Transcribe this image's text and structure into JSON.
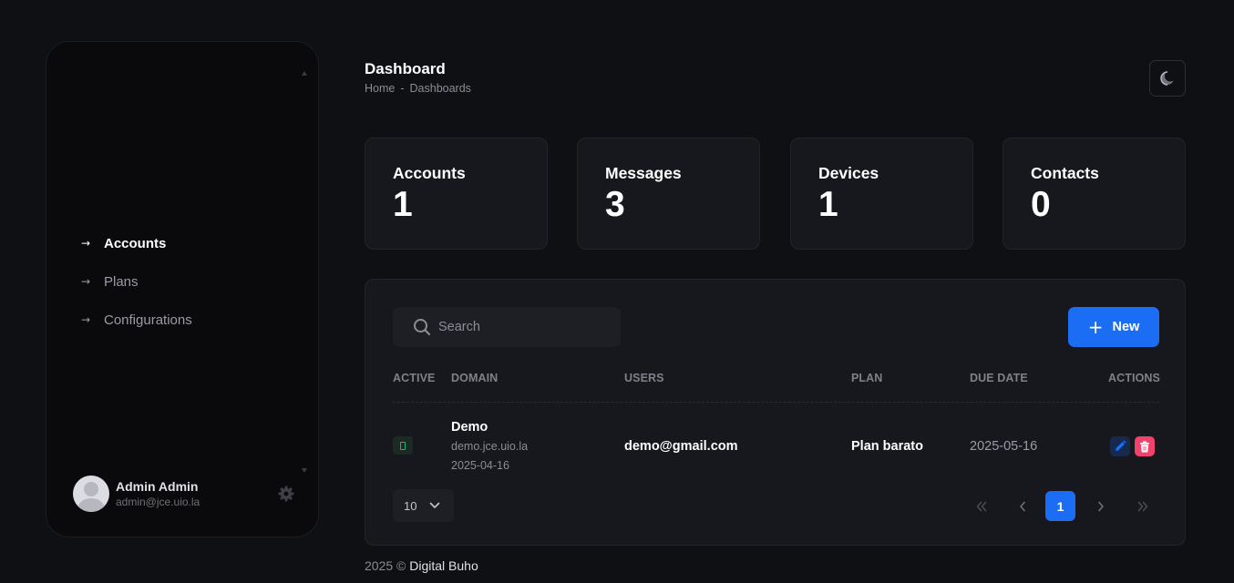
{
  "header": {
    "title": "Dashboard",
    "breadcrumb": {
      "home": "Home",
      "separator": "-",
      "current": "Dashboards"
    },
    "theme_icon": "moon-icon"
  },
  "sidebar": {
    "items": [
      {
        "label": "Accounts",
        "icon": "arrow-right-icon",
        "active": true
      },
      {
        "label": "Plans",
        "icon": "arrow-right-icon",
        "active": false
      },
      {
        "label": "Configurations",
        "icon": "arrow-right-icon",
        "active": false
      }
    ],
    "arrow_glyph": "→",
    "user": {
      "name": "Admin Admin",
      "email": "admin@jce.uio.la",
      "settings_icon": "gear-icon"
    }
  },
  "stats": [
    {
      "label": "Accounts",
      "value": "1"
    },
    {
      "label": "Messages",
      "value": "3"
    },
    {
      "label": "Devices",
      "value": "1"
    },
    {
      "label": "Contacts",
      "value": "0"
    }
  ],
  "table": {
    "search_placeholder": "Search",
    "new_button": {
      "plus": "+",
      "label": "New"
    },
    "columns": [
      "ACTIVE",
      "DOMAIN",
      "USERS",
      "PLAN",
      "DUE DATE",
      "ACTIONS"
    ],
    "rows": [
      {
        "active": true,
        "domain_name": "Demo",
        "domain_url": "demo.jce.uio.la",
        "domain_date": "2025-04-16",
        "user": "demo@gmail.com",
        "plan": "Plan barato",
        "due_date": "2025-05-16"
      }
    ],
    "page_size": "10",
    "current_page": "1"
  },
  "footer": {
    "text": "2025 ©",
    "brand": "Digital Buho"
  },
  "colors": {
    "background": "#0f1014",
    "card": "#17181d",
    "primary": "#1b6ef3",
    "danger": "#f1416c",
    "success": "#1fb578"
  }
}
